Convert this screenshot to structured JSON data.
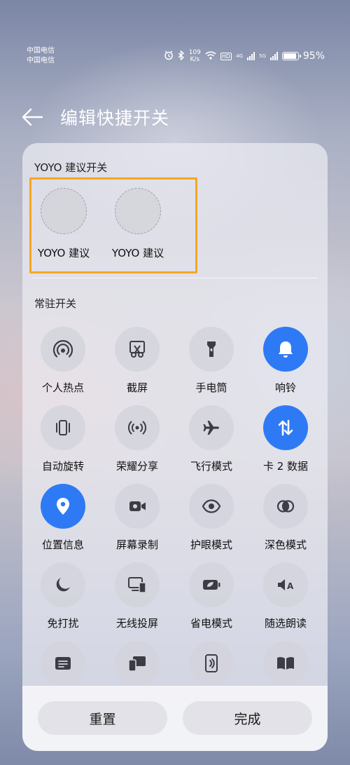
{
  "status_bar": {
    "carrier_1": "中国电信",
    "carrier_2": "中国电信",
    "net_speed_value": "109",
    "net_speed_unit": "K/s",
    "hd_badge": "HD",
    "sim1_type": "4G",
    "sim2_type": "5G",
    "battery_percent": "95%",
    "battery_level": 0.95
  },
  "header": {
    "title": "编辑快捷开关"
  },
  "suggest_section": {
    "title": "YOYO 建议开关",
    "items": [
      {
        "label": "YOYO 建议"
      },
      {
        "label": "YOYO 建议"
      }
    ]
  },
  "resident_section": {
    "title": "常驻开关",
    "tiles": [
      {
        "label": "个人热点",
        "icon": "hotspot-icon",
        "active": false
      },
      {
        "label": "截屏",
        "icon": "screenshot-icon",
        "active": false
      },
      {
        "label": "手电筒",
        "icon": "flashlight-icon",
        "active": false
      },
      {
        "label": "响铃",
        "icon": "bell-icon",
        "active": true
      },
      {
        "label": "自动旋转",
        "icon": "auto-rotate-icon",
        "active": false
      },
      {
        "label": "荣耀分享",
        "icon": "share-icon",
        "active": false
      },
      {
        "label": "飞行模式",
        "icon": "airplane-icon",
        "active": false
      },
      {
        "label": "卡 2 数据",
        "icon": "mobile-data-icon",
        "active": true
      },
      {
        "label": "位置信息",
        "icon": "location-icon",
        "active": true
      },
      {
        "label": "屏幕录制",
        "icon": "screen-record-icon",
        "active": false
      },
      {
        "label": "护眼模式",
        "icon": "eye-icon",
        "active": false
      },
      {
        "label": "深色模式",
        "icon": "dark-mode-icon",
        "active": false
      },
      {
        "label": "免打扰",
        "icon": "moon-icon",
        "active": false
      },
      {
        "label": "无线投屏",
        "icon": "wireless-projection-icon",
        "active": false
      },
      {
        "label": "省电模式",
        "icon": "battery-saver-icon",
        "active": false
      },
      {
        "label": "随选朗读",
        "icon": "read-aloud-icon",
        "active": false
      },
      {
        "label": "",
        "icon": "notes-icon",
        "active": false
      },
      {
        "label": "",
        "icon": "multi-device-icon",
        "active": false
      },
      {
        "label": "",
        "icon": "nfc-card-icon",
        "active": false
      },
      {
        "label": "",
        "icon": "book-icon",
        "active": false
      }
    ]
  },
  "footer": {
    "reset_label": "重置",
    "done_label": "完成"
  },
  "colors": {
    "accent": "#2e7af5",
    "highlight_border": "#f5a623"
  }
}
